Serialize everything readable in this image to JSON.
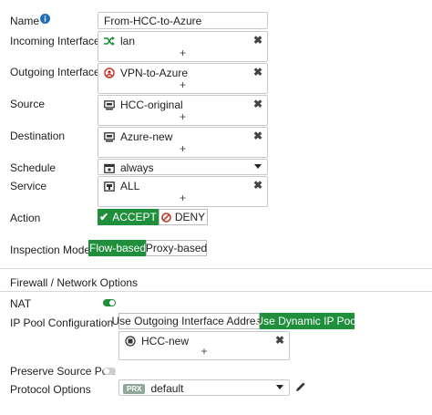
{
  "form": {
    "name": {
      "label": "Name",
      "value": "From-HCC-to-Azure",
      "info_icon": "info-icon"
    },
    "incoming": {
      "label": "Incoming Interface",
      "value": "lan",
      "icon": "shuffle-icon",
      "add": "+"
    },
    "outgoing": {
      "label": "Outgoing Interface",
      "value": "VPN-to-Azure",
      "icon": "vpn-icon",
      "add": "+"
    },
    "source": {
      "label": "Source",
      "value": "HCC-original",
      "icon": "address-icon",
      "add": "+"
    },
    "destination": {
      "label": "Destination",
      "value": "Azure-new",
      "icon": "address-icon",
      "add": "+"
    },
    "schedule": {
      "label": "Schedule",
      "value": "always",
      "icon": "schedule-icon"
    },
    "service": {
      "label": "Service",
      "value": "ALL",
      "icon": "service-icon",
      "add": "+"
    },
    "action": {
      "label": "Action",
      "accept": "ACCEPT",
      "deny": "DENY",
      "selected": "ACCEPT"
    },
    "inspection": {
      "label": "Inspection Mode",
      "flow": "Flow-based",
      "proxy": "Proxy-based",
      "selected": "Flow-based"
    }
  },
  "firewall": {
    "section_title": "Firewall / Network Options",
    "nat": {
      "label": "NAT",
      "enabled": true
    },
    "ip_pool": {
      "label": "IP Pool Configuration",
      "option_outgoing": "Use Outgoing Interface Address",
      "option_dynamic": "Use Dynamic IP Pool",
      "selected": "Use Dynamic IP Pool",
      "pool_value": "HCC-new",
      "pool_icon": "pool-icon",
      "add": "+"
    },
    "preserve_port": {
      "label": "Preserve Source Port",
      "enabled": false
    },
    "protocol": {
      "label": "Protocol Options",
      "badge": "PRX",
      "value": "default"
    }
  },
  "colors": {
    "accent": "#1f8f3b",
    "deny": "#c0392b",
    "info": "#1e6fb8",
    "vpn": "#c0392b"
  }
}
